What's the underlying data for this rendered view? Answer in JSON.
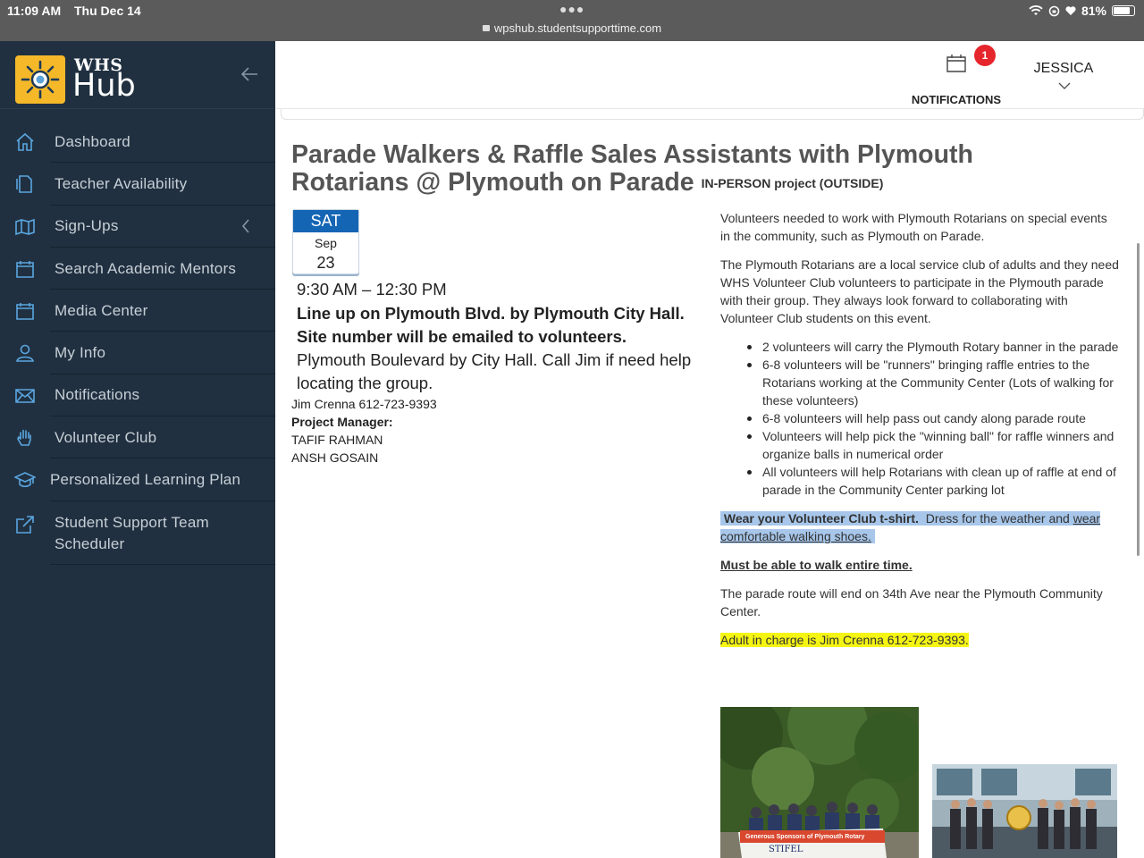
{
  "status_bar": {
    "time": "11:09 AM",
    "date": "Thu Dec 14",
    "url": "wpshub.studentsupporttime.com",
    "battery": "81%",
    "battery_level": 0.81
  },
  "brand": {
    "whs": "WHS",
    "hub": "Hub"
  },
  "sidebar": {
    "items": [
      {
        "label": "Dashboard",
        "icon": "home-icon"
      },
      {
        "label": "Teacher Availability",
        "icon": "document-icon"
      },
      {
        "label": "Sign-Ups",
        "icon": "map-icon"
      },
      {
        "label": "Search Academic Mentors",
        "icon": "calendar-icon"
      },
      {
        "label": "Media Center",
        "icon": "calendar-icon"
      },
      {
        "label": "My Info",
        "icon": "user-icon"
      },
      {
        "label": "Notifications",
        "icon": "envelope-icon"
      },
      {
        "label": "Volunteer Club",
        "icon": "hand-icon"
      },
      {
        "label": "Personalized Learning Plan",
        "icon": "graduation-cap-icon"
      },
      {
        "label": "Student Support Team Scheduler",
        "icon": "external-link-icon"
      }
    ]
  },
  "header": {
    "notifications_label": "NOTIFICATIONS",
    "notifications_count": "1",
    "user_name": "JESSICA"
  },
  "event": {
    "title": "Parade Walkers & Raffle Sales Assistants with Plymouth Rotarians @ Plymouth on Parade",
    "subtitle": "IN-PERSON project (OUTSIDE)",
    "date": {
      "dow": "SAT",
      "month": "Sep",
      "day": "23"
    },
    "time": "9:30 AM – 12:30 PM",
    "location_bold": "Line up on Plymouth Blvd. by Plymouth City Hall. Site number will be emailed to volunteers.",
    "location_plain": "Plymouth Boulevard by City Hall. Call Jim if need help locating the group.",
    "contact": "Jim Crenna 612-723-9393",
    "pm_label": "Project Manager:",
    "managers": [
      "TAFIF RAHMAN",
      "ANSH GOSAIN"
    ]
  },
  "description": {
    "p1": "Volunteers needed to work with Plymouth Rotarians on special events in the community, such as Plymouth on Parade.",
    "p2": "The Plymouth Rotarians are a local service club of adults and they need WHS Volunteer Club volunteers to participate in the Plymouth parade with their group.  They always look forward to collaborating with Volunteer Club students on this event.",
    "bullets": [
      "2 volunteers will carry the Plymouth Rotary banner in the parade",
      "6-8 volunteers will be \"runners\" bringing raffle entries to the Rotarians working at the Community Center (Lots of walking for these volunteers)",
      "6-8 volunteers will help pass out candy along parade route",
      "Volunteers will help pick the \"winning ball\" for raffle winners and organize balls in numerical order",
      "All volunteers will help Rotarians with clean up of raffle at end of parade in the Community Center parking lot"
    ],
    "wear_bold": "Wear your Volunteer Club t-shirt.",
    "wear_mid": "Dress for the weather and ",
    "wear_underline": "wear comfortable walking shoes.",
    "must_walk": "Must be able to walk entire time.",
    "route": "The parade route will end on 34th Ave near the Plymouth Community Center.",
    "adult": "Adult in charge is Jim Crenna  612-723-9393."
  },
  "photos": {
    "banner_line1": "Generous Sponsors of Plymouth Rotary",
    "banner_line2": "STIFEL"
  },
  "colors": {
    "sidebar_bg": "#203040",
    "accent_blue": "#1565b5",
    "badge_red": "#e5262c",
    "highlight_blue": "#a7c6ea",
    "highlight_yellow": "#f5f514",
    "logo_yellow": "#f4b829"
  }
}
